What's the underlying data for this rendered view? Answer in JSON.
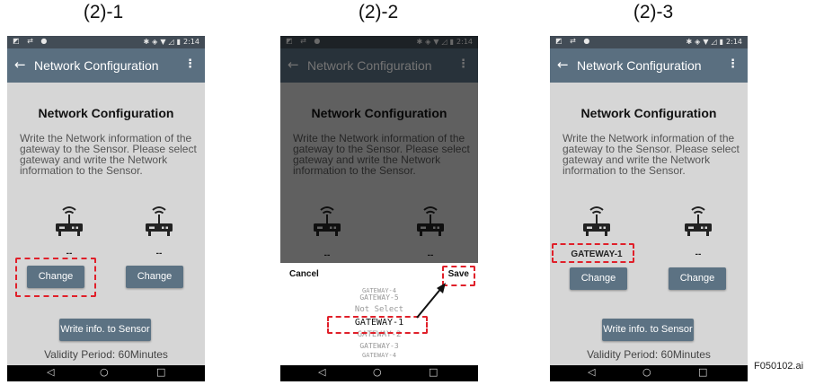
{
  "captions": [
    "(2)-1",
    "(2)-2",
    "(2)-3"
  ],
  "status": {
    "left_icons": "◩ ⇄ ●",
    "time": "2:14"
  },
  "appbar": {
    "back": "←",
    "title": "Network Configuration",
    "menu": "⋮"
  },
  "content": {
    "heading": "Network Configuration",
    "description": "Write the Network information of the gateway to the Sensor. Please select gateway and write the Network information to the Sensor.",
    "empty_label": "--",
    "selected_gateway": "GATEWAY-1",
    "change_label": "Change",
    "write_label": "Write info. to Sensor",
    "validity": "Validity Period: 60Minutes"
  },
  "picker": {
    "cancel": "Cancel",
    "save": "Save",
    "options": [
      "GATEWAY-4",
      "GATEWAY-5",
      "Not Select",
      "GATEWAY-1",
      "GATEWAY-2",
      "GATEWAY-3",
      "GATEWAY-4"
    ],
    "selected_index": 3
  },
  "nav": {
    "back": "◁",
    "home": "○",
    "recent": "□"
  },
  "figure_id": "F050102.ai",
  "colors": {
    "highlight": "#e0202a",
    "appbar": "#5a6f80",
    "button": "#5c7283"
  }
}
